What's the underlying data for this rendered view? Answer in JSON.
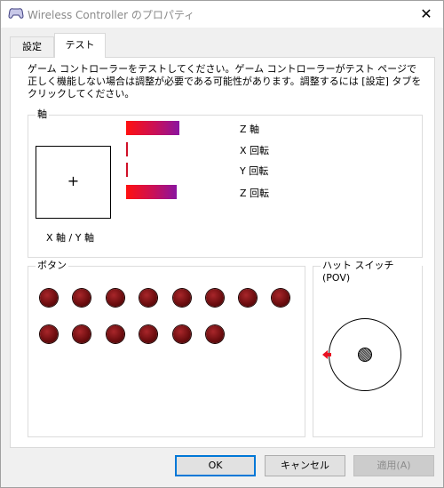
{
  "window": {
    "title": "Wireless Controller のプロパティ",
    "close_glyph": "✕"
  },
  "tabs": [
    {
      "label": "設定",
      "selected": false
    },
    {
      "label": "テスト",
      "selected": true
    }
  ],
  "description": "ゲーム コントローラーをテストしてください。ゲーム コントローラーがテスト ページで正しく機能しない場合は調整が必要である可能性があります。調整するには [設定] タブをクリックしてください。",
  "axes": {
    "group_label": "軸",
    "xy_label": "X 軸 / Y 軸",
    "crosshair_glyph": "+",
    "items": [
      {
        "label": "Z 軸",
        "level": 0.8
      },
      {
        "label": "X 回転",
        "level": 0.0
      },
      {
        "label": "Y 回転",
        "level": 0.0
      },
      {
        "label": "Z 回転",
        "level": 0.75
      }
    ]
  },
  "buttons_group": {
    "label": "ボタン",
    "count": 14
  },
  "hat_switch": {
    "label": "ハット スイッチ (POV)",
    "direction": "left",
    "arrow_color": "#e81123"
  },
  "footer": {
    "ok": "OK",
    "cancel": "キャンセル",
    "apply": "適用(A)"
  }
}
